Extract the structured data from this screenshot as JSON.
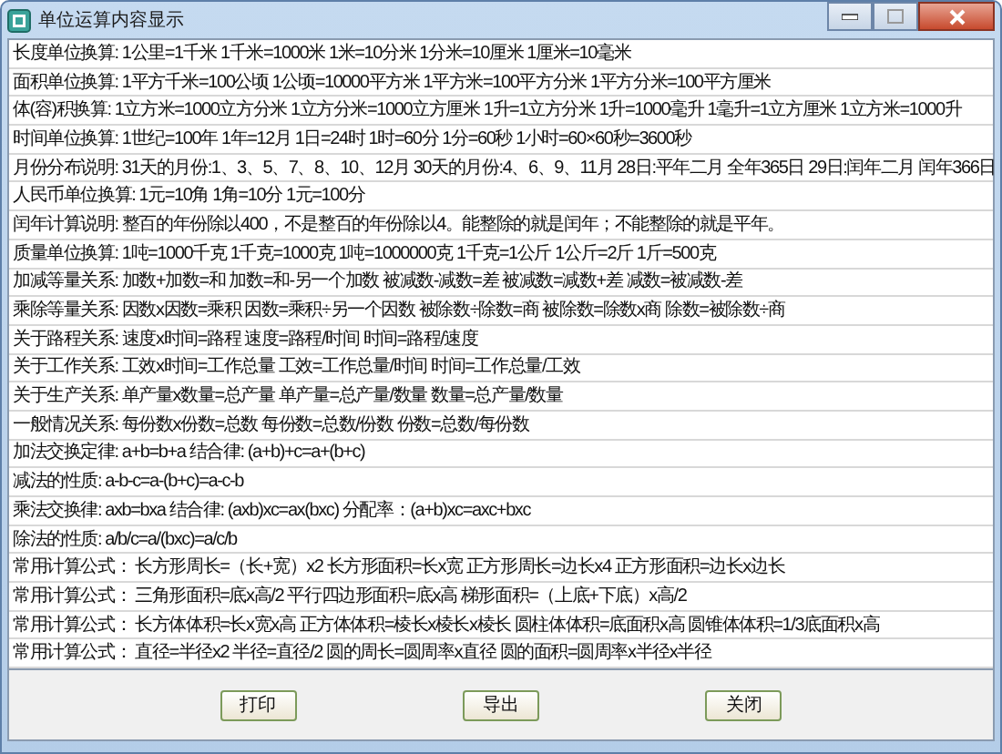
{
  "window": {
    "title": "单位运算内容显示"
  },
  "rows": [
    {
      "label": "长度单位换算:",
      "text": "1公里=1千米  1千米=1000米  1米=10分米  1分米=10厘米  1厘米=10毫米"
    },
    {
      "label": "面积单位换算:",
      "text": "1平方千米=100公顷  1公顷=10000平方米  1平方米=100平方分米  1平方分米=100平方厘米"
    },
    {
      "label": "体(容)积换算:",
      "text": "1立方米=1000立方分米  1立方分米=1000立方厘米  1升=1立方分米  1升=1000毫升  1毫升=1立方厘米  1立方米=1000升"
    },
    {
      "label": "时间单位换算:",
      "text": "1世纪=100年  1年=12月  1日=24时  1时=60分  1分=60秒  1小时=60×60秒=3600秒"
    },
    {
      "label": "月份分布说明:",
      "text": "31天的月份:1、3、5、7、8、10、12月  30天的月份:4、6、9、11月 28日:平年二月 全年365日 29日:闰年二月 闰年366日"
    },
    {
      "label": "人民币单位换算:",
      "text": "1元=10角  1角=10分   1元=100分"
    },
    {
      "label": "闰年计算说明:",
      "text": "整百的年份除以400，不是整百的年份除以4。能整除的就是闰年；不能整除的就是平年。"
    },
    {
      "label": "质量单位换算:",
      "text": "1吨=1000千克  1千克=1000克  1吨=1000000克  1千克=1公斤  1公斤=2斤  1斤=500克"
    },
    {
      "label": "加减等量关系:",
      "text": "加数+加数=和  加数=和-另一个加数   被减数-减数=差  被减数=减数+差  减数=被减数-差"
    },
    {
      "label": "乘除等量关系:",
      "text": "因数x因数=乘积  因数=乘积÷另一个因数  被除数÷除数=商  被除数=除数x商  除数=被除数÷商"
    },
    {
      "label": "关于路程关系:",
      "text": " 速度x时间=路程  速度=路程/时间  时间=路程/速度"
    },
    {
      "label": "关于工作关系:",
      "text": " 工效x时间=工作总量  工效=工作总量/时间   时间=工作总量/工效"
    },
    {
      "label": "关于生产关系:",
      "text": " 单产量x数量=总产量  单产量=总产量/数量  数量=总产量/数量"
    },
    {
      "label": "一般情况关系:",
      "text": " 每份数x份数=总数  每份数=总数/份数  份数=总数/每份数"
    },
    {
      "label": "加法交换定律:",
      "text": " a+b=b+a  结合律: (a+b)+c=a+(b+c)"
    },
    {
      "label": "减法的性质:",
      "text": " a-b-c=a-(b+c)=a-c-b"
    },
    {
      "label": "乘法交换律:",
      "text": " axb=bxa   结合律: (axb)xc=ax(bxc)   分配率：(a+b)xc=axc+bxc"
    },
    {
      "label": "除法的性质:",
      "text": " a/b/c=a/(bxc)=a/c/b"
    },
    {
      "label": "常用计算公式：",
      "text": " 长方形周长=（长+宽）x2  长方形面积=长x宽  正方形周长=边长x4  正方形面积=边长x边长"
    },
    {
      "label": "常用计算公式：",
      "text": " 三角形面积=底x高/2  平行四边形面积=底x高  梯形面积=（上底+下底）x高/2"
    },
    {
      "label": "常用计算公式：",
      "text": " 长方体体积=长x宽x高  正方体体积=棱长x棱长x棱长  圆柱体体积=底面积x高  圆锥体体积=1/3底面积x高"
    },
    {
      "label": "常用计算公式：",
      "text": " 直径=半径x2  半径=直径/2  圆的周长=圆周率x直径  圆的面积=圆周率x半径x半径"
    }
  ],
  "buttons": [
    "打印",
    "导出",
    "关闭"
  ]
}
